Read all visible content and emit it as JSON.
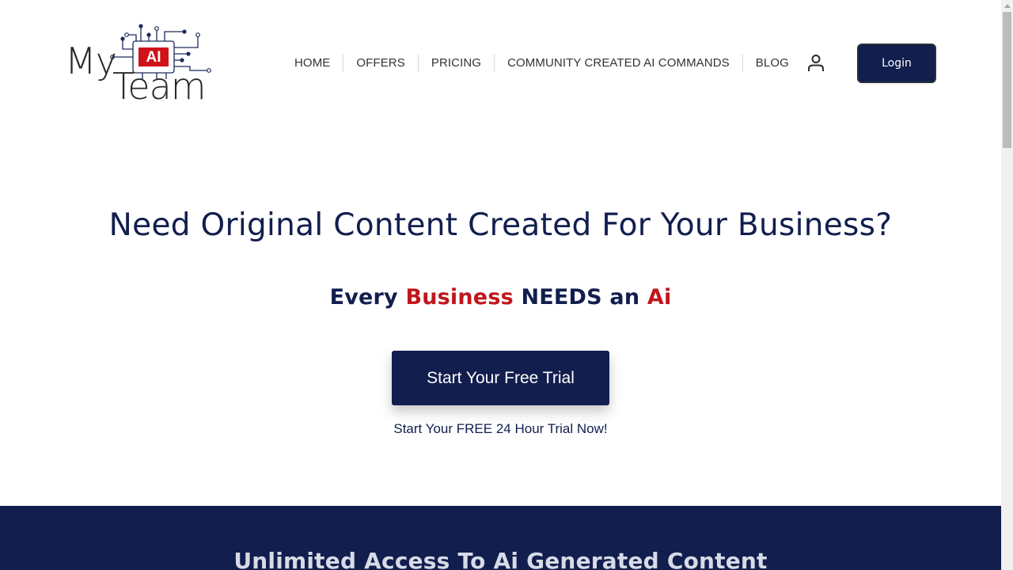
{
  "logo": {
    "line1": "My",
    "line2": "Team",
    "badge": "AI",
    "colors": {
      "badge_bg": "#d0121b",
      "circuit": "#1d2a5a",
      "text": "#2a2a2a"
    }
  },
  "nav": {
    "items": [
      {
        "label": "HOME"
      },
      {
        "label": "OFFERS"
      },
      {
        "label": "PRICING"
      },
      {
        "label": "COMMUNITY CREATED AI COMMANDS"
      },
      {
        "label": "BLOG"
      }
    ],
    "account_icon": "user-icon",
    "login_label": "Login"
  },
  "hero": {
    "title": "Need Original Content Created For Your Business?",
    "subtitle_parts": {
      "p1": "Every ",
      "p2": "Business",
      "p3": " NEEDS an ",
      "p4": "Ai"
    },
    "cta_label": "Start Your Free Trial",
    "cta_note": "Start Your FREE 24 Hour Trial Now!"
  },
  "section": {
    "title": "Unlimited Access To Ai Generated Content"
  },
  "colors": {
    "primary": "#111e4e",
    "accent_red": "#c0161c",
    "nav_text": "#333333"
  }
}
